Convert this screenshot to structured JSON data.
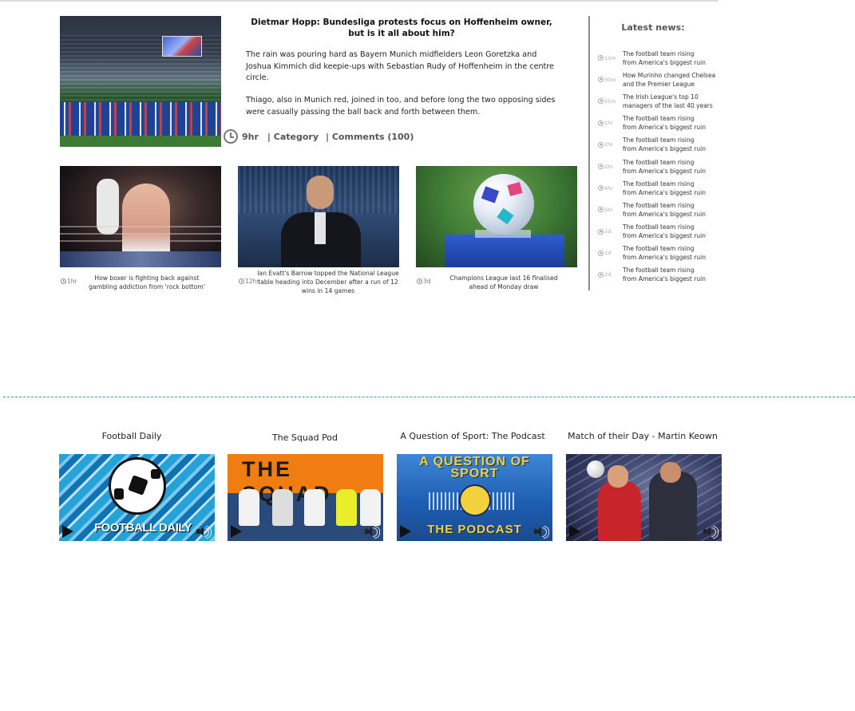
{
  "featured": {
    "image_alt": "Bayern Munich and Hoffenheim players on the pitch",
    "title_line1": "Dietmar Hopp: Bundesliga protests focus on Hoffenheim owner,",
    "title_line2": "but is it all about him?",
    "paragraph1": "The rain was pouring hard as Bayern Munich midfielders Leon Goretzka and Joshua Kimmich did keepie-ups with Sebastian Rudy of Hoffenheim in the centre circle.",
    "paragraph2": "Thiago, also in Munich red, joined in too, and before long the two opposing sides were casually passing the ball back and forth between them.",
    "time": "9hr",
    "category": "| Category",
    "comments": "| Comments (100)",
    "icon": "clock-icon"
  },
  "cards": [
    {
      "time": "1hr",
      "caption": "How boxer is fighting back against gambling addiction from 'rock bottom'",
      "icon": "clock-icon"
    },
    {
      "time": "12hr",
      "caption": "Ian Evatt's Barrow topped the National League table heading into December after a run of 12 wins in 14 games",
      "icon": "clock-icon"
    },
    {
      "time": "3d",
      "caption": "Champions League last 16 finalised ahead of Monday draw",
      "icon": "clock-icon"
    }
  ],
  "latest_news": {
    "title": "Latest news:",
    "items": [
      {
        "time": "10m",
        "text": "The football team rising\nfrom America's biggest ruin"
      },
      {
        "time": "30m",
        "text": "How Murinho changed Chelsea\nand the Premier League"
      },
      {
        "time": "55m",
        "text": "The Irish League's top 10\nmanagers of the last 40 years"
      },
      {
        "time": "1hr",
        "text": "The football team rising\nfrom America's biggest ruin"
      },
      {
        "time": "2hr",
        "text": "The football team rising\nfrom America's biggest ruin"
      },
      {
        "time": "2hr",
        "text": "The football team rising\nfrom America's biggest ruin"
      },
      {
        "time": "4hr",
        "text": "The football team rising\nfrom America's biggest ruin"
      },
      {
        "time": "5hr",
        "text": "The football team rising\nfrom America's biggest ruin"
      },
      {
        "time": "1d",
        "text": "The football team rising\nfrom America's biggest ruin"
      },
      {
        "time": "1d",
        "text": "The football team rising\nfrom America's biggest ruin"
      },
      {
        "time": "2d",
        "text": "The football team rising\nfrom America's biggest ruin"
      }
    ]
  },
  "podcasts": [
    {
      "title": "Football Daily",
      "art_text": "FOOTBALL DAILY",
      "play_icon": "play-icon",
      "volume_icon": "volume-icon"
    },
    {
      "title": "The Squad Pod",
      "art_text": "THE SQUAD",
      "play_icon": "play-icon",
      "volume_icon": "volume-icon"
    },
    {
      "title": "A Question of Sport: The Podcast",
      "art_text": "A QUESTION OF SPORT",
      "art_text_2": "THE PODCAST",
      "play_icon": "play-icon",
      "volume_icon": "volume-icon"
    },
    {
      "title": "Match of their Day - Martin Keown",
      "play_icon": "play-icon",
      "volume_icon": "volume-icon"
    }
  ],
  "colors": {
    "divider": "#8c8c8c",
    "dashed_separator": "#3a93a8",
    "meta_text": "#555555"
  }
}
